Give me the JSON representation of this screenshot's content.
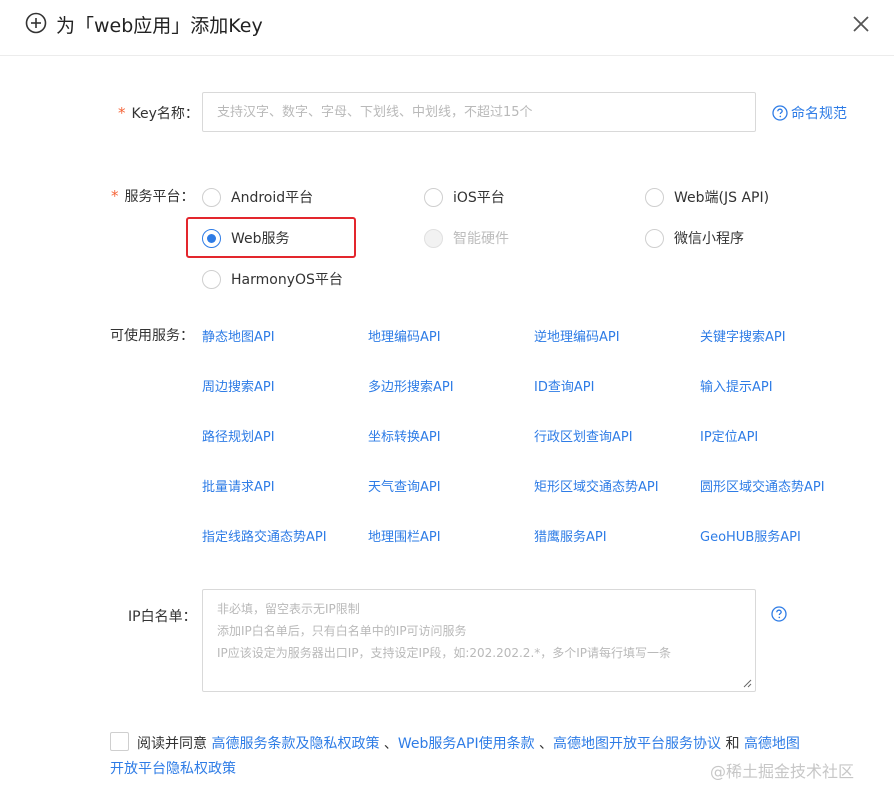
{
  "dialog": {
    "title": "为「web应用」添加Key",
    "icon": "plus-circle-icon",
    "close_icon": "close-icon"
  },
  "key_name": {
    "required_mark": "*",
    "label": "Key名称：",
    "placeholder": "支持汉字、数字、字母、下划线、中划线，不超过15个",
    "value": "",
    "help_link": "命名规范"
  },
  "platform": {
    "required_mark": "*",
    "label": "服务平台：",
    "options": [
      {
        "label": "Android平台",
        "checked": false,
        "disabled": false
      },
      {
        "label": "iOS平台",
        "checked": false,
        "disabled": false
      },
      {
        "label": "Web端(JS API)",
        "checked": false,
        "disabled": false
      },
      {
        "label": "Web服务",
        "checked": true,
        "disabled": false
      },
      {
        "label": "智能硬件",
        "checked": false,
        "disabled": true
      },
      {
        "label": "微信小程序",
        "checked": false,
        "disabled": false
      },
      {
        "label": "HarmonyOS平台",
        "checked": false,
        "disabled": false
      }
    ],
    "highlight_color": "#e3262d"
  },
  "services": {
    "label": "可使用服务：",
    "items": [
      "静态地图API",
      "地理编码API",
      "逆地理编码API",
      "关键字搜索API",
      "周边搜索API",
      "多边形搜索API",
      "ID查询API",
      "输入提示API",
      "路径规划API",
      "坐标转换API",
      "行政区划查询API",
      "IP定位API",
      "批量请求API",
      "天气查询API",
      "矩形区域交通态势API",
      "圆形区域交通态势API",
      "指定线路交通态势API",
      "地理围栏API",
      "猎鹰服务API",
      "GeoHUB服务API"
    ]
  },
  "ip_whitelist": {
    "label": "IP白名单：",
    "placeholder": "非必填，留空表示无IP限制\n添加IP白名单后，只有白名单中的IP可访问服务\nIP应该设定为服务器出口IP，支持设定IP段，如:202.202.2.*，多个IP请每行填写一条",
    "value": ""
  },
  "agreement": {
    "prefix": "阅读并同意",
    "link1": "高德服务条款及隐私权政策",
    "sep1": "、",
    "link2": "Web服务API使用条款",
    "sep2": "、",
    "link3": "高德地图开放平台服务协议",
    "and": "和",
    "link4a": "高德地图",
    "link4b": "开放平台隐私权政策",
    "checked": false
  },
  "watermark": "@稀土掘金技术社区",
  "colors": {
    "accent": "#2e7ce6",
    "required": "#f5653a",
    "highlight": "#e3262d"
  }
}
